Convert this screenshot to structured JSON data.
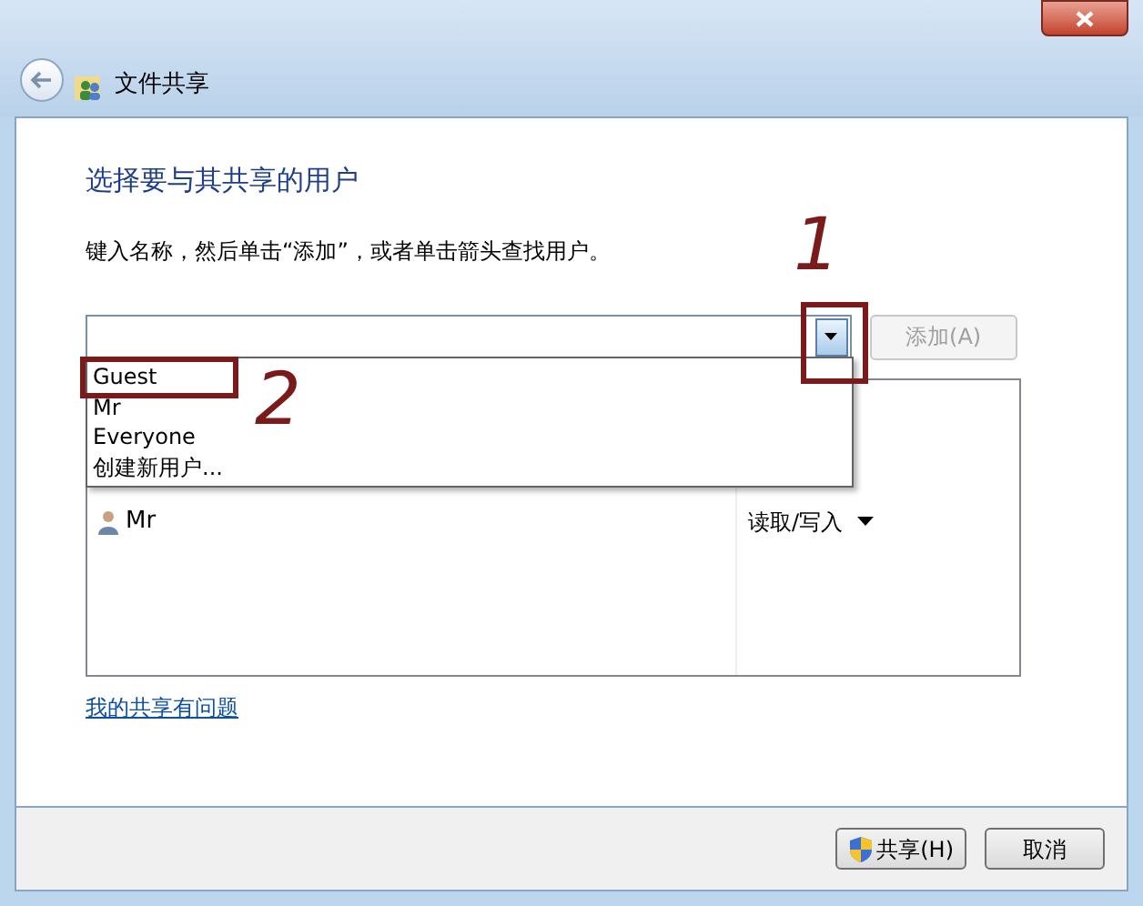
{
  "window": {
    "title": "文件共享"
  },
  "heading": "选择要与其共享的用户",
  "instruction": "键入名称，然后单击“添加”，或者单击箭头查找用户。",
  "add_button": {
    "label": "添加(A)",
    "disabled": true
  },
  "dropdown": {
    "items": [
      "Guest",
      "Mr",
      "Everyone",
      "创建新用户..."
    ]
  },
  "users": [
    {
      "name": "Mr",
      "permission": "读取/写入"
    }
  ],
  "help_link": "我的共享有问题",
  "buttons": [
    {
      "label": "共享(H)",
      "shield": true
    },
    {
      "label": "取消",
      "shield": false
    }
  ],
  "annotations": [
    {
      "label": "1"
    },
    {
      "label": "2"
    }
  ]
}
